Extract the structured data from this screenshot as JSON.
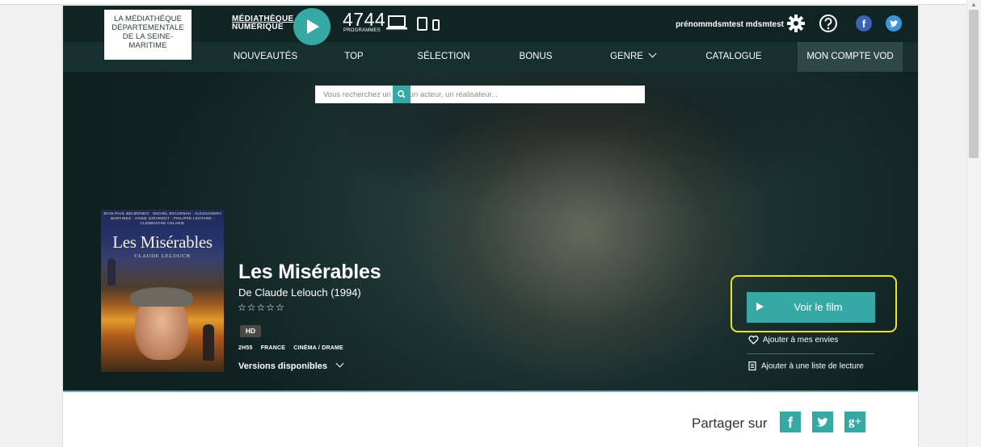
{
  "header": {
    "logo_lines": [
      "LA MÉDIATHÈQUE",
      "DÉPARTEMENTALE",
      "DE LA SEINE-",
      "MARITIME"
    ],
    "brand_line1": "MÉDIATHÈQUE",
    "brand_line2": "NUMÉRIQUE",
    "programs_count": "4744",
    "programs_label": "PROGRAMMES",
    "username": "prénommdsmtest mdsmtest",
    "facebook_letter": "f"
  },
  "nav": {
    "items": [
      "NOUVEAUTÉS",
      "TOP",
      "SÉLECTION",
      "BONUS",
      "GENRE",
      "CATALOGUE",
      "MON COMPTE VOD"
    ],
    "active": "MON COMPTE VOD"
  },
  "search": {
    "placeholder": "Vous recherchez un film, un acteur, un réalisateur..."
  },
  "poster": {
    "top_text": "JEAN-PAUL BELMONDO · MICHEL BOUJENAH · ALESSANDRA MARTINES · ANNIE GIRARDOT · PHILIPPE LEOTARD · CLEMENTINE CELARIE",
    "title": "Les Misérables",
    "director": "CLAUDE LELOUCH"
  },
  "movie": {
    "title": "Les Misérables",
    "subtitle": "De Claude Lelouch (1994)",
    "stars": "☆☆☆☆☆",
    "quality": "HD",
    "duration": "2H55",
    "country": "FRANCE",
    "genre": "CINÉMA / DRAME",
    "versions_label": "Versions disponibles"
  },
  "actions": {
    "watch_label": "Voir le film",
    "wishlist_label": "Ajouter à mes envies",
    "playlist_label": "Ajouter à une liste de lecture"
  },
  "share": {
    "label": "Partager sur",
    "facebook_letter": "f",
    "google_plus": "g+"
  },
  "colors": {
    "accent": "#37a9a4",
    "header_bg": "#102423",
    "nav_bg": "#15302f",
    "highlight": "#f2e21b"
  }
}
